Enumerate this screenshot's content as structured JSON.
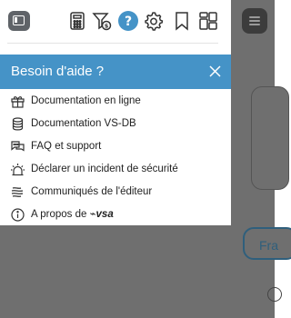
{
  "toolbar": {
    "icons": [
      "sidebar-toggle-icon",
      "calculator-icon",
      "filter-dollar-icon",
      "help-icon",
      "gear-icon",
      "bookmark-icon",
      "dashboard-icon"
    ]
  },
  "help_panel": {
    "title": "Besoin d'aide ?",
    "items": [
      {
        "label": "Documentation en ligne",
        "icon": "gift-box-icon"
      },
      {
        "label": "Documentation VS-DB",
        "icon": "database-icon"
      },
      {
        "label": "FAQ et support",
        "icon": "chat-bubbles-icon"
      },
      {
        "label": "Déclarer un incident de sécurité",
        "icon": "alarm-light-icon"
      },
      {
        "label": "Communiqués de l'éditeur",
        "icon": "wind-icon"
      },
      {
        "label": "A propos de",
        "icon": "info-icon",
        "logo": "vsa"
      }
    ]
  },
  "background": {
    "pill_text": "Fra"
  },
  "colors": {
    "accent": "#4593c7",
    "overlay": "#6f6f6f",
    "icon": "#333333"
  }
}
